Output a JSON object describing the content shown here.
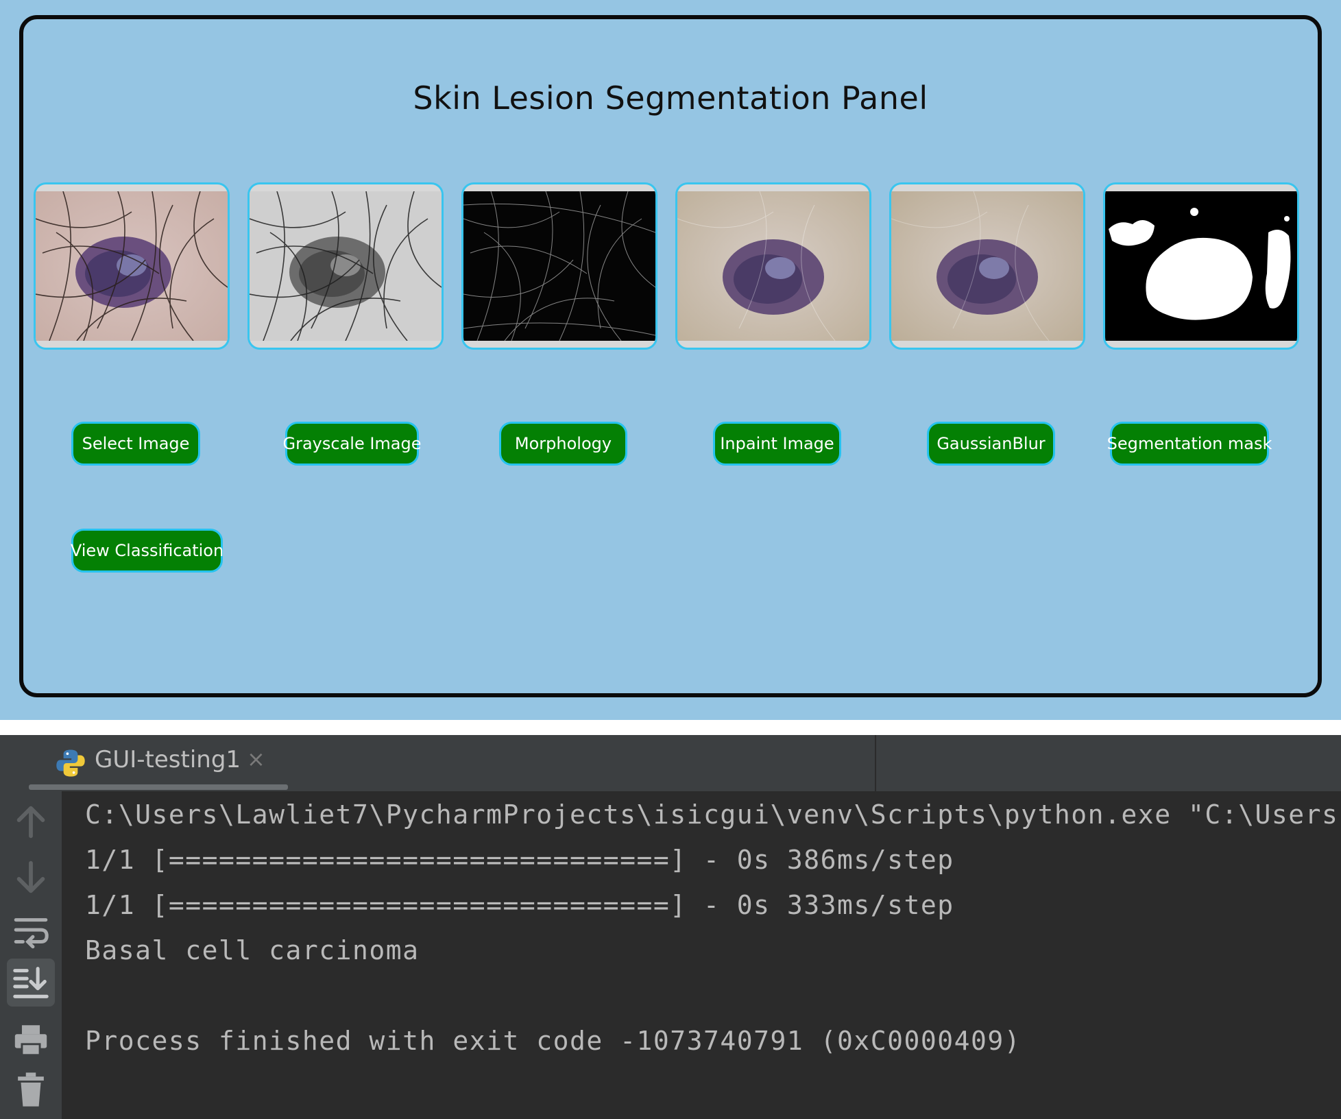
{
  "panel": {
    "title": "Skin Lesion Segmentation Panel"
  },
  "thumbnails": [
    {
      "name": "original-image",
      "style": "color"
    },
    {
      "name": "grayscale-image",
      "style": "gray"
    },
    {
      "name": "morphology-image",
      "style": "hairs"
    },
    {
      "name": "inpaint-image",
      "style": "clean"
    },
    {
      "name": "gaussianblur-image",
      "style": "clean"
    },
    {
      "name": "segmentation-mask-image",
      "style": "mask"
    }
  ],
  "buttons": {
    "select_image": "Select Image",
    "grayscale_image": "Grayscale Image",
    "morphology": "Morphology",
    "inpaint_image": "Inpaint Image",
    "gaussian_blur": "GaussianBlur",
    "segmentation_mask": "Segmentation mask",
    "view_classification": "View Classification"
  },
  "ide": {
    "tab_label": "GUI-testing1",
    "tab_close": "×",
    "gutter_icons": [
      "up-arrow-icon",
      "down-arrow-icon",
      "soft-wrap-icon",
      "scroll-to-end-icon",
      "print-icon",
      "trash-icon"
    ],
    "console_lines": [
      "C:\\Users\\Lawliet7\\PycharmProjects\\isicgui\\venv\\Scripts\\python.exe \"C:\\Users",
      "1/1 [==============================] - 0s 386ms/step",
      "1/1 [==============================] - 0s 333ms/step",
      "Basal cell carcinoma",
      "",
      "Process finished with exit code -1073740791 (0xC0000409)"
    ]
  },
  "colors": {
    "gui_background": "#95c5e3",
    "button_green": "#048004",
    "button_border": "#26c3ee",
    "console_bg": "#2b2b2b",
    "console_text": "#b9b9b9"
  }
}
